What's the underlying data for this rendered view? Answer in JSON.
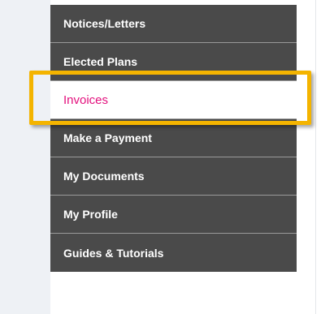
{
  "menu": {
    "items": [
      {
        "label": "Notices/Letters"
      },
      {
        "label": "Elected Plans"
      },
      {
        "label": "Invoices"
      },
      {
        "label": "Make a Payment"
      },
      {
        "label": "My Documents"
      },
      {
        "label": "My Profile"
      },
      {
        "label": "Guides & Tutorials"
      }
    ],
    "active_index": 2
  },
  "colors": {
    "menu_bg": "#4a4a4a",
    "active_text": "#e3107d",
    "highlight": "#f4b400"
  }
}
